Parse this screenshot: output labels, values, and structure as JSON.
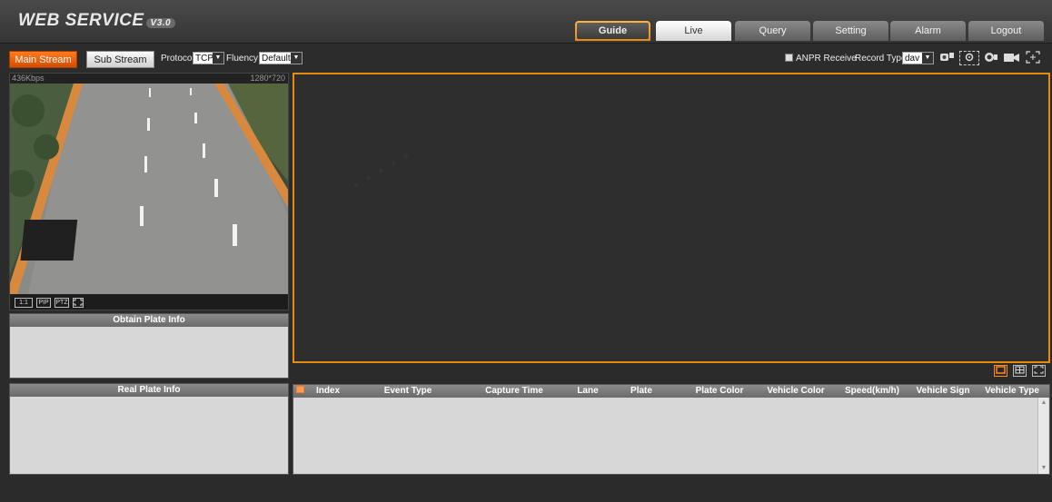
{
  "app": {
    "title": "WEB SERVICE",
    "version": "V3.0"
  },
  "nav": {
    "tabs": [
      "Guide",
      "Live",
      "Query",
      "Setting",
      "Alarm",
      "Logout"
    ],
    "active": "Live"
  },
  "toolbar": {
    "main_stream": "Main Stream",
    "sub_stream": "Sub Stream",
    "protocol_label": "Protocol",
    "protocol_value": "TCP",
    "fluency_label": "Fluency",
    "fluency_value": "Default",
    "anpr_label": "ANPR Receive",
    "record_type_label": "Record Type",
    "record_type_value": "dav",
    "icons": [
      "snapshot-hand-icon",
      "capture-settings-icon",
      "record-icon",
      "video-camera-icon",
      "fullscreen-icon"
    ]
  },
  "camera": {
    "bitrate": "436Kbps",
    "resolution": "1280*720",
    "buttons": [
      "1:1",
      "PIP",
      "PTZ"
    ]
  },
  "panels": {
    "obtain_plate": "Obtain Plate Info",
    "real_plate": "Real Plate Info"
  },
  "table": {
    "columns": [
      "Index",
      "Event Type",
      "Capture Time",
      "Lane",
      "Plate",
      "Plate Color",
      "Vehicle Color",
      "Speed(km/h)",
      "Vehicle Sign",
      "Vehicle Type"
    ],
    "rows": []
  },
  "colors": {
    "accent": "#e58b10",
    "main_stream": "#ff7a1f",
    "panel": "#d7d7d7"
  }
}
